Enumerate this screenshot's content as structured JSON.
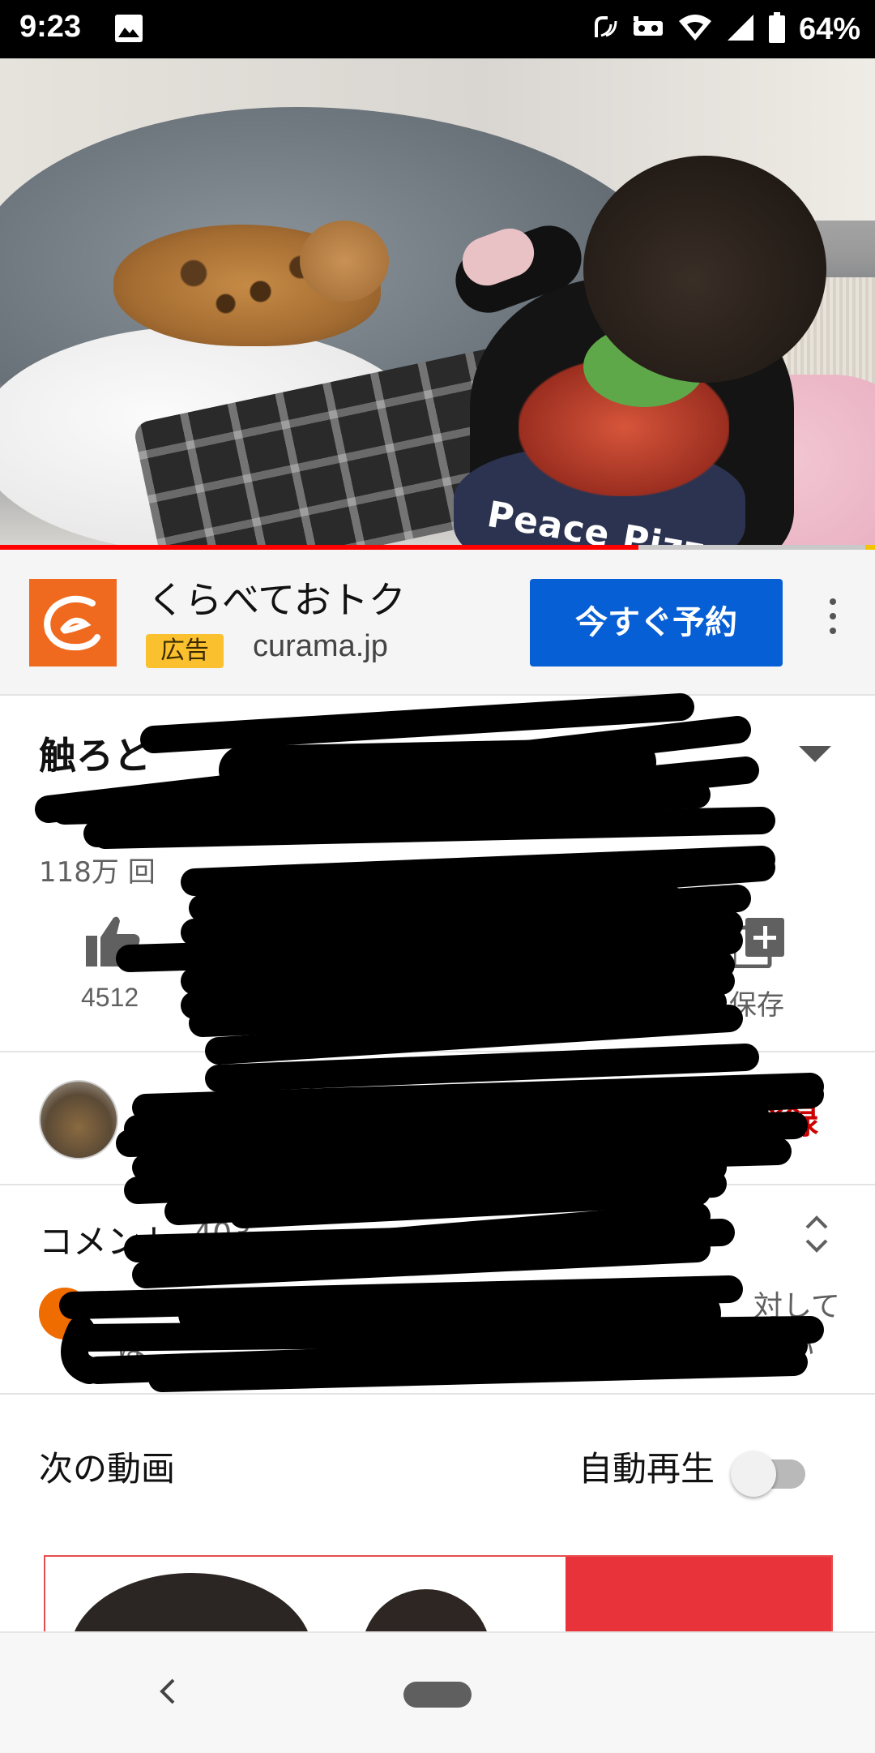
{
  "status_bar": {
    "time": "9:23",
    "battery": "64%",
    "icons": [
      "gallery-icon",
      "nfc-icon",
      "vr-icon",
      "wifi-icon",
      "signal-icon",
      "battery-icon"
    ]
  },
  "video": {
    "overlay_text": "Peace Pizz",
    "progress": 0.73
  },
  "ad": {
    "title": "くらべておトク",
    "badge": "広告",
    "domain": "curama.jp",
    "cta": "今すぐ予約",
    "accent": "#065fd4",
    "logo_color": "#ef6a1f"
  },
  "video_info": {
    "title_visible": "触ろと",
    "views_visible": "118万 回",
    "like_count_visible": "4512",
    "save_label": "保存"
  },
  "channel": {
    "subscribe_label_visible": "登録",
    "subscribe_color": "#cc0000"
  },
  "comments": {
    "label": "コメント",
    "count_visible": "403",
    "snippet_right_1": "対して",
    "snippet_left_2": "は",
    "snippet_right_2": "い"
  },
  "up_next": {
    "label": "次の動画",
    "autoplay_label": "自動再生",
    "autoplay_on": false
  }
}
